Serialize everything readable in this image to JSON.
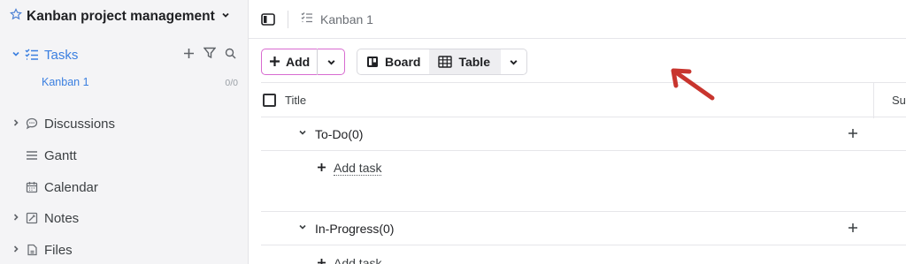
{
  "sidebar": {
    "project_title": "Kanban project management",
    "items": [
      {
        "label": "Tasks",
        "icon": "task-list-icon",
        "active": true
      },
      {
        "label": "Discussions",
        "icon": "chat-bubble-icon"
      },
      {
        "label": "Gantt",
        "icon": "gantt-lines-icon"
      },
      {
        "label": "Calendar",
        "icon": "calendar-icon"
      },
      {
        "label": "Notes",
        "icon": "notes-icon"
      },
      {
        "label": "Files",
        "icon": "file-icon"
      }
    ],
    "sub_item": {
      "label": "Kanban 1",
      "count": "0/0"
    }
  },
  "topbar": {
    "breadcrumb": "Kanban 1"
  },
  "toolbar": {
    "add_label": "Add",
    "board_label": "Board",
    "table_label": "Table"
  },
  "grid": {
    "title_col": "Title",
    "second_col": "Su",
    "groups": [
      {
        "name": "To-Do(0)",
        "add_task": "Add task"
      },
      {
        "name": "In-Progress(0)",
        "add_task": "Add task"
      }
    ]
  },
  "colors": {
    "accent": "#3a7fe0",
    "add_border": "#d86bd0",
    "annotation_arrow": "#c8352e"
  }
}
